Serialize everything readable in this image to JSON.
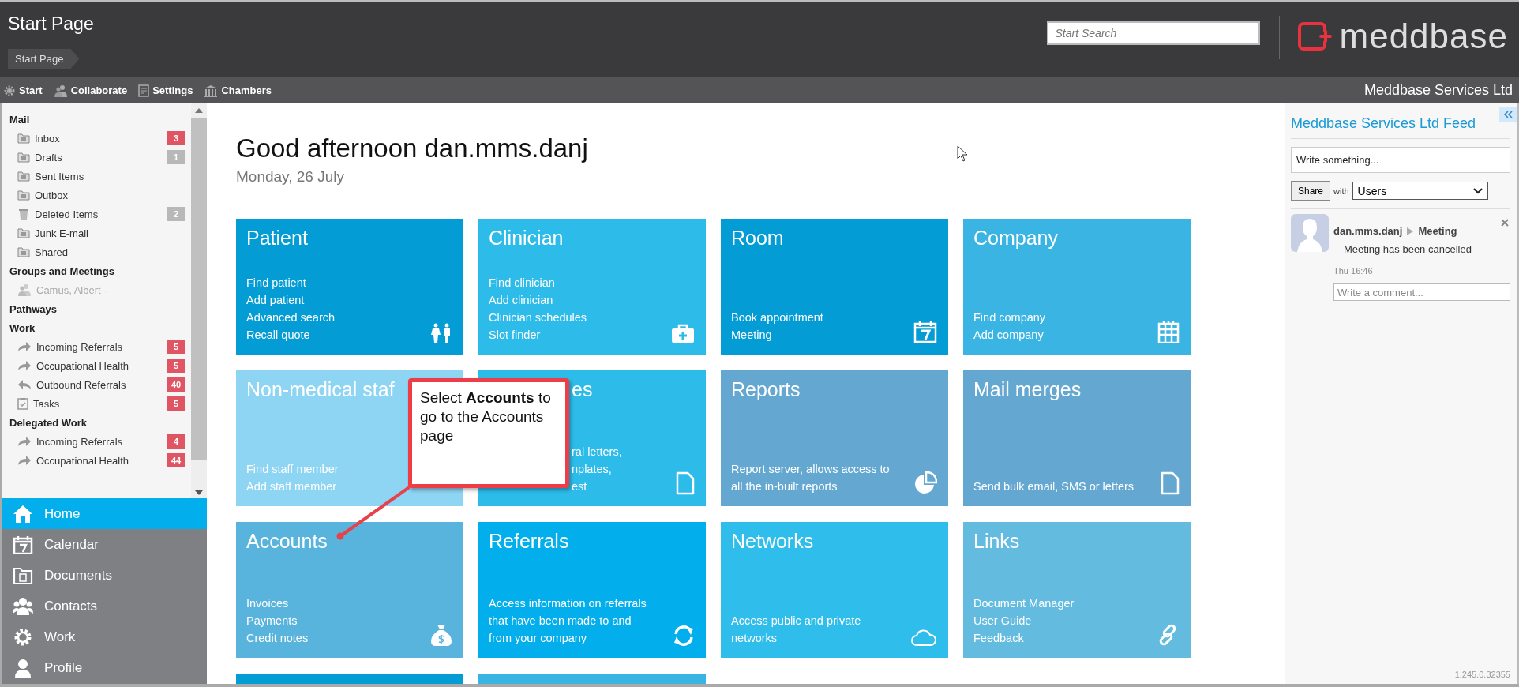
{
  "header": {
    "title": "Start Page",
    "breadcrumb": "Start Page",
    "search": {
      "placeholder": "Start Search"
    },
    "logo_text": "meddbase"
  },
  "toolbar": {
    "items": [
      {
        "label": "Start",
        "kind": "gear"
      },
      {
        "label": "Collaborate",
        "kind": "people"
      },
      {
        "label": "Settings",
        "kind": "sheet"
      },
      {
        "label": "Chambers",
        "kind": "columns"
      }
    ],
    "organisation": "Meddbase Services Ltd"
  },
  "sidebar": {
    "sections": [
      {
        "title": "Mail",
        "items": [
          {
            "label": "Inbox",
            "kind": "folder",
            "disabled": false,
            "badge": "3",
            "color": "#e05563"
          },
          {
            "label": "Drafts",
            "kind": "folder",
            "disabled": false,
            "badge": "1",
            "color": "#b8b8b8"
          },
          {
            "label": "Sent Items",
            "kind": "folder",
            "disabled": false
          },
          {
            "label": "Outbox",
            "kind": "folder",
            "disabled": false
          },
          {
            "label": "Deleted Items",
            "kind": "trash",
            "disabled": false,
            "badge": "2",
            "color": "#b8b8b8"
          },
          {
            "label": "Junk E-mail",
            "kind": "folder",
            "disabled": false
          },
          {
            "label": "Shared",
            "kind": "folder",
            "disabled": false
          }
        ]
      },
      {
        "title": "Groups and Meetings",
        "items": [
          {
            "label": "Camus, Albert -",
            "kind": "group",
            "disabled": true
          }
        ]
      },
      {
        "title": "Pathways"
      },
      {
        "title": "Work",
        "items": [
          {
            "label": "Incoming Referrals",
            "kind": "forward",
            "disabled": false,
            "badge": "5",
            "color": "#e05563"
          },
          {
            "label": "Occupational Health",
            "kind": "forward",
            "disabled": false,
            "badge": "5",
            "color": "#e05563"
          },
          {
            "label": "Outbound Referrals",
            "kind": "back",
            "disabled": false,
            "badge": "40",
            "color": "#e05563"
          },
          {
            "label": "Tasks",
            "kind": "clipboard",
            "disabled": false,
            "badge": "5",
            "color": "#e05563"
          }
        ]
      },
      {
        "title": "Delegated Work",
        "items": [
          {
            "label": "Incoming Referrals",
            "kind": "forward",
            "disabled": false,
            "badge": "4",
            "color": "#e05563"
          },
          {
            "label": "Occupational Health",
            "kind": "forward",
            "disabled": false,
            "badge": "44",
            "color": "#e05563"
          }
        ]
      }
    ],
    "nav": [
      {
        "label": "Home",
        "kind": "home",
        "selected": true
      },
      {
        "label": "Calendar",
        "kind": "calendar",
        "selected": false
      },
      {
        "label": "Documents",
        "kind": "folder",
        "selected": false
      },
      {
        "label": "Contacts",
        "kind": "contacts",
        "selected": false
      },
      {
        "label": "Work",
        "kind": "gear",
        "selected": false
      },
      {
        "label": "Profile",
        "kind": "person",
        "selected": false
      }
    ]
  },
  "greeting": {
    "title": "Good afternoon dan.mms.danj",
    "date": "Monday, 26 July"
  },
  "tiles": [
    {
      "title": "Patient",
      "lines": [
        "Find patient",
        "Add patient",
        "Advanced search",
        "Recall quote"
      ],
      "kind": "people",
      "color": "#039cd5",
      "covered": false
    },
    {
      "title": "Clinician",
      "lines": [
        "Find clinician",
        "Add clinician",
        "Clinician schedules",
        "Slot finder"
      ],
      "kind": "medkit",
      "color": "#2dbbea",
      "covered": false
    },
    {
      "title": "Room",
      "lines": [
        "Book appointment",
        "Meeting"
      ],
      "kind": "calendar",
      "color": "#039cd5",
      "covered": false
    },
    {
      "title": "Company",
      "lines": [
        "Find company",
        "Add company"
      ],
      "kind": "building",
      "color": "#3ab4e2",
      "covered": false
    },
    {
      "title": "Non-medical staf",
      "lines": [
        "Find staff member",
        "Add staff member"
      ],
      "kind": "none",
      "color": "#8ed4f3",
      "covered": false
    },
    {
      "title": "es",
      "lines": [
        "ral letters,",
        "nplates,",
        "est"
      ],
      "kind": "document",
      "color": "#2dbbea",
      "covered": true
    },
    {
      "title": "Reports",
      "lines": [
        "Report server, allows access to all the in-built reports"
      ],
      "kind": "pie",
      "color": "#64a7d1",
      "covered": false
    },
    {
      "title": "Mail merges",
      "lines": [
        "Send bulk email, SMS or letters"
      ],
      "kind": "document",
      "color": "#64a7d1",
      "covered": false
    },
    {
      "title": "Accounts",
      "lines": [
        "Invoices",
        "Payments",
        "Credit notes"
      ],
      "kind": "moneybag",
      "color": "#58b4dc",
      "covered": false
    },
    {
      "title": "Referrals",
      "lines": [
        "Access information on referrals that have been made to and from your company"
      ],
      "kind": "refresh",
      "color": "#02aeeb",
      "covered": false
    },
    {
      "title": "Networks",
      "lines": [
        "Access public and private networks"
      ],
      "kind": "cloud",
      "color": "#2fbdeb",
      "covered": false
    },
    {
      "title": "Links",
      "lines": [
        "Document Manager",
        "User Guide",
        "Feedback"
      ],
      "kind": "link",
      "color": "#63bcdf",
      "covered": false
    }
  ],
  "callout": "Select **Accounts** to go to the Accounts page",
  "feed": {
    "title": "Meddbase Services Ltd Feed",
    "post_field": {
      "placeholder": "Write something..."
    },
    "share_button": "Share",
    "with_label": "with",
    "audience": "Users",
    "posts": [
      {
        "author": "dan.mms.danj",
        "target": "Meeting",
        "message": "Meeting has been cancelled",
        "time": "Thu 16:46",
        "comment_field": {
          "placeholder": "Write a comment..."
        }
      }
    ],
    "version": "1.245.0.32355"
  }
}
